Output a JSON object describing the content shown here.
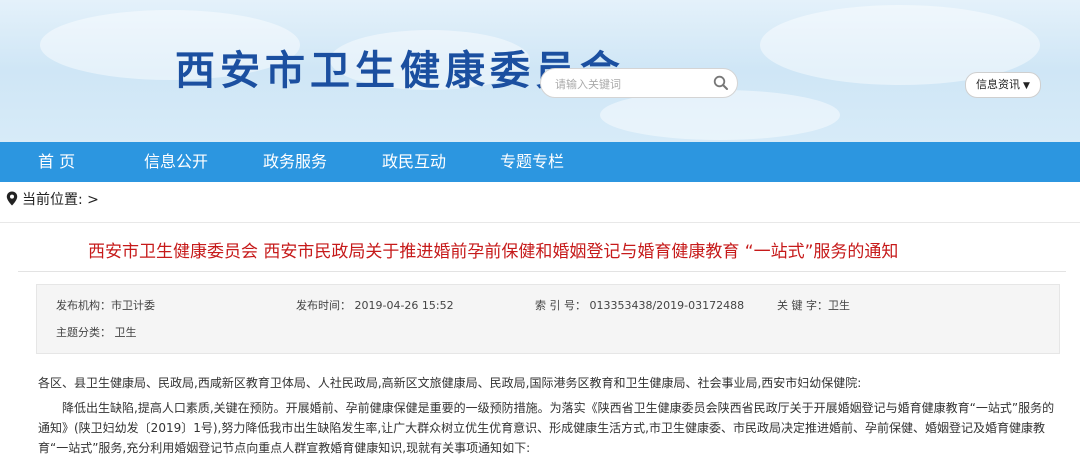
{
  "header": {
    "site_title": "西安市卫生健康委员会",
    "search_placeholder": "请输入关键词",
    "search_icon": "search-icon",
    "info_select": "信息资讯",
    "info_select_arrow": "▼"
  },
  "nav": {
    "items": [
      {
        "label": "首 页"
      },
      {
        "label": "信息公开"
      },
      {
        "label": "政务服务"
      },
      {
        "label": "政民互动"
      },
      {
        "label": "专题专栏"
      }
    ]
  },
  "breadcrumb": {
    "label": "当前位置: >",
    "icon": "location-pin-icon"
  },
  "article": {
    "title": "西安市卫生健康委员会 西安市民政局关于推进婚前孕前保健和婚姻登记与婚育健康教育 “一站式”服务的通知",
    "meta": {
      "publisher": "发布机构：市卫计委",
      "publish_time": "发布时间： 2019-04-26 15:52",
      "index_no": "索 引 号： 013353438/2019-03172488",
      "keywords": "关 键 字：卫生",
      "category": "主题分类： 卫生"
    },
    "body": {
      "recipients": "各区、县卫生健康局、民政局,西咸新区教育卫体局、人社民政局,高新区文旅健康局、民政局,国际港务区教育和卫生健康局、社会事业局,西安市妇幼保健院:",
      "para1": "降低出生缺陷,提高人口素质,关键在预防。开展婚前、孕前健康保健是重要的一级预防措施。为落实《陕西省卫生健康委员会陕西省民政厅关于开展婚姻登记与婚育健康教育“一站式”服务的通知》(陕卫妇幼发〔2019〕1号),努力降低我市出生缺陷发生率,让广大群众树立优生优育意识、形成健康生活方式,市卫生健康委、市民政局决定推进婚前、孕前保健、婚姻登记及婚育健康教育“一站式”服务,充分利用婚姻登记节点向重点人群宣教婚育健康知识,现就有关事项通知如下:"
    }
  },
  "colors": {
    "brand_blue": "#1b4fa0",
    "nav_blue": "#2c96e0",
    "title_red": "#c61a1a"
  }
}
